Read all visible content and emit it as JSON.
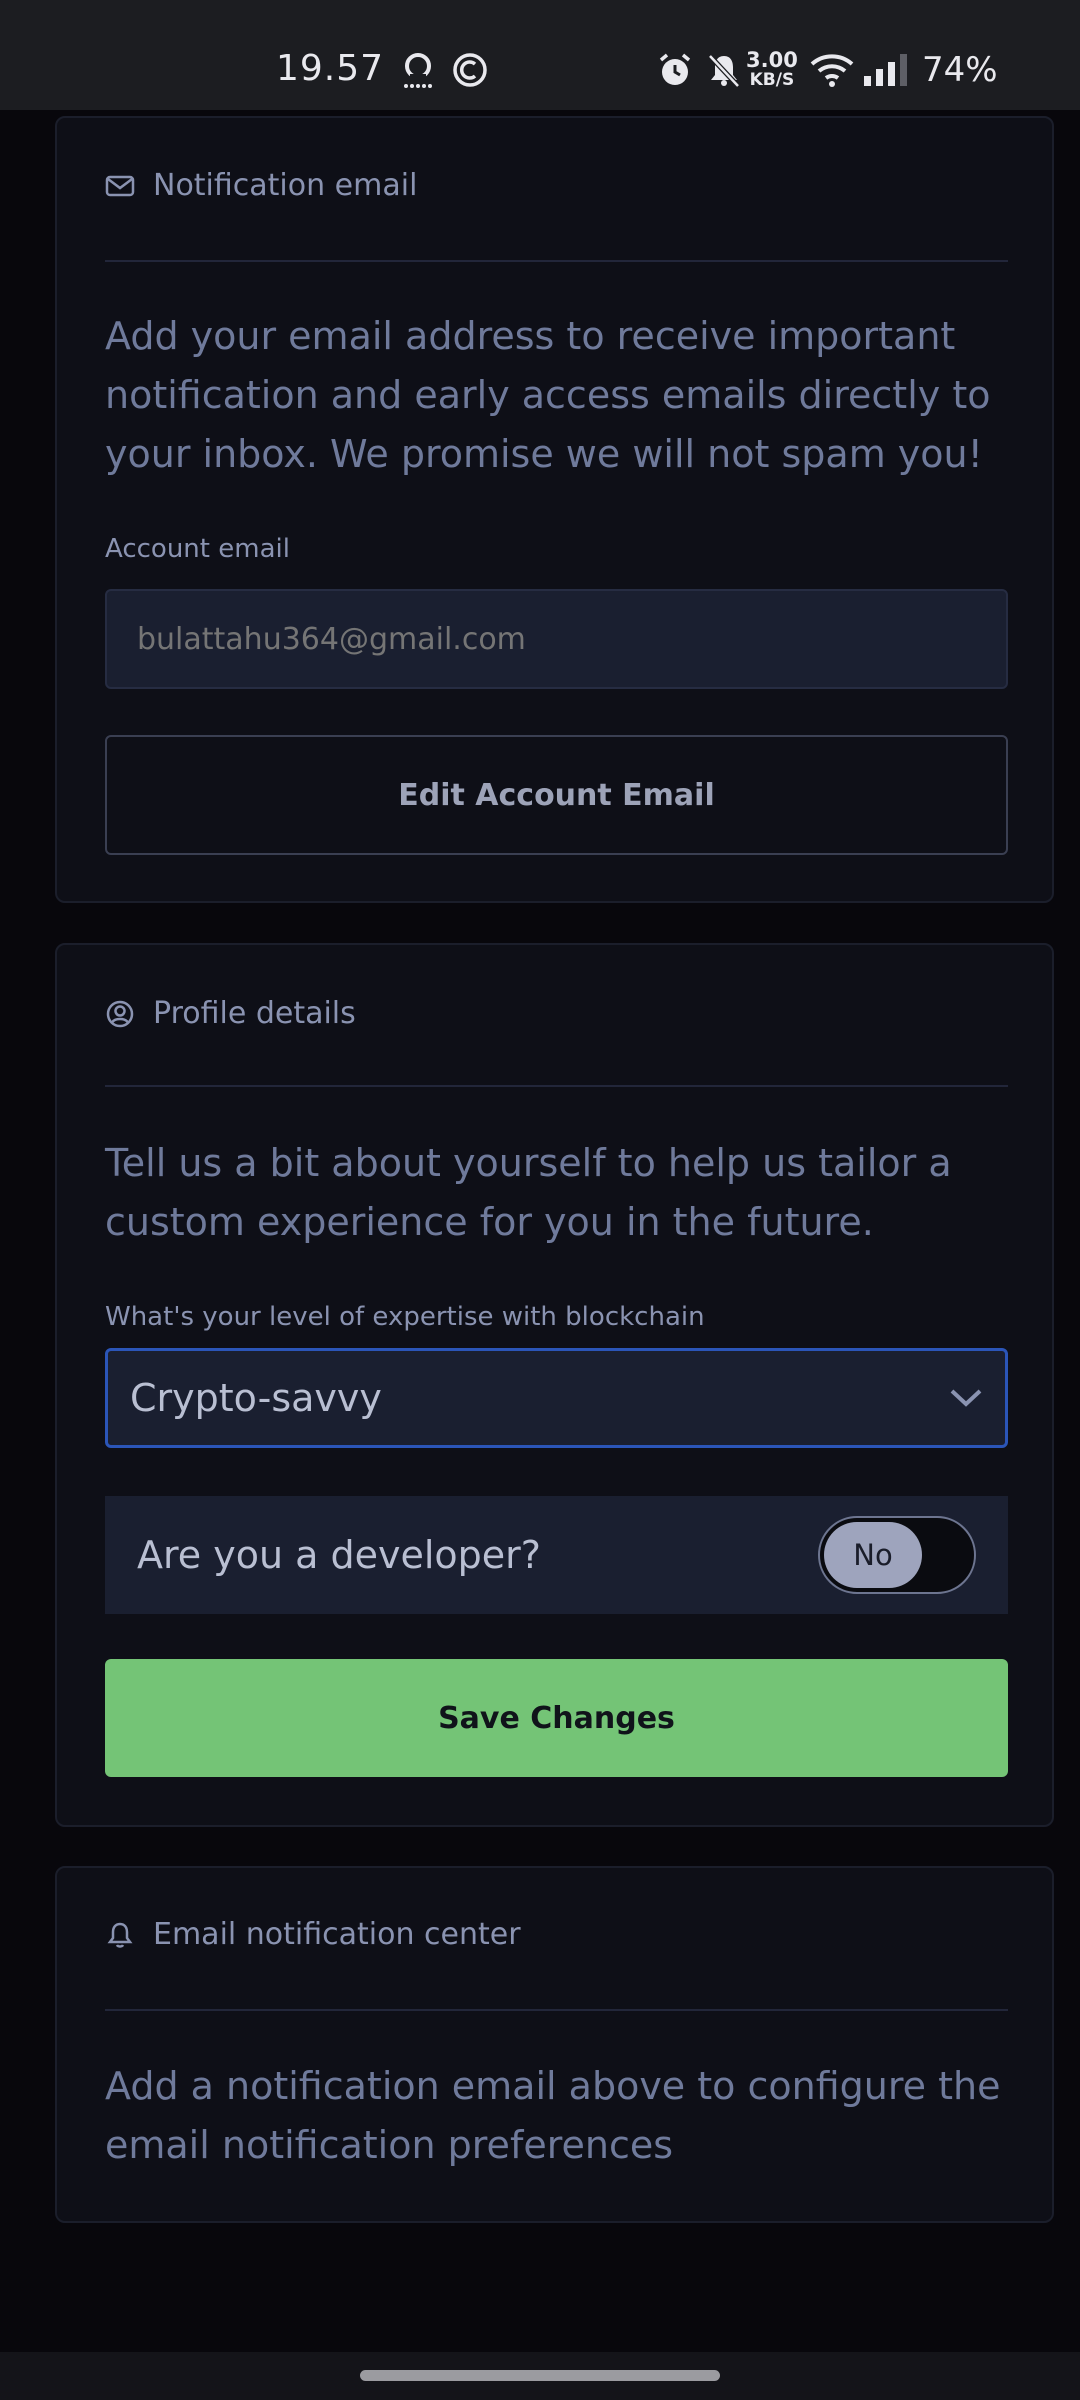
{
  "status_bar": {
    "time": "19.57",
    "net_speed_value": "3.00",
    "net_speed_unit": "KB/S",
    "battery": "74%"
  },
  "notification_card": {
    "title": "Notification email",
    "description": "Add your email address to receive important notification and early access emails directly to your inbox. We promise we will not spam you!",
    "account_email_label": "Account email",
    "account_email_placeholder": "bulattahu364@gmail.com",
    "edit_button_label": "Edit Account Email"
  },
  "profile_card": {
    "title": "Profile details",
    "description": "Tell us a bit about yourself to help us tailor a custom experience for you in the future.",
    "expertise_label": "What's your level of expertise with blockchain",
    "expertise_value": "Crypto-savvy",
    "developer_question": "Are you a developer?",
    "developer_toggle_label": "No",
    "save_button_label": "Save Changes"
  },
  "email_center_card": {
    "title": "Email notification center",
    "description": "Add a notification email above to configure the email notification preferences"
  },
  "colors": {
    "accent_green": "#74c476",
    "focus_blue": "#2b55b8",
    "card_bg": "#0e0f17"
  }
}
